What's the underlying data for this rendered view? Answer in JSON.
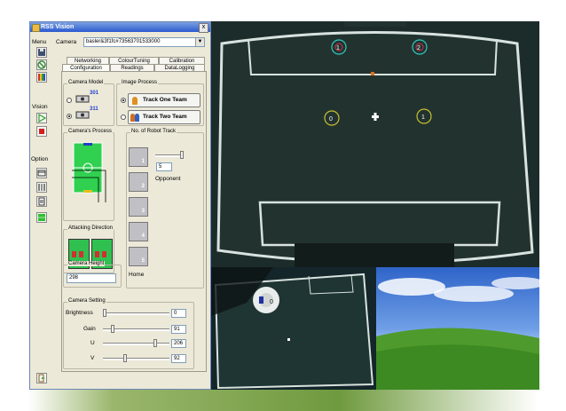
{
  "window": {
    "title": "RSS Vision",
    "close_label": "x"
  },
  "left_toolbar": {
    "menu_label": "Menu",
    "vision_label": "Vision",
    "option_label": "Option",
    "menu_icons": [
      "save-icon",
      "no-entry-icon",
      "color-bars-icon"
    ],
    "vision_icons": [
      "play-icon",
      "stop-icon"
    ],
    "option_icons": [
      "film-icon",
      "tools-icon",
      "document-icon",
      "field-icon"
    ],
    "exit_icon": "exit-icon"
  },
  "camera": {
    "label": "Camera",
    "selected": "basler&3f1fc#73563701533000"
  },
  "tabs": {
    "row1": [
      "Networking",
      "ColourTuning",
      "Calibration"
    ],
    "row2": [
      "Configuration",
      "Readings",
      "DataLogging"
    ],
    "active": "Configuration"
  },
  "camera_model": {
    "title": "Camera Model",
    "options": [
      "301",
      "311"
    ],
    "selected": "311"
  },
  "image_process": {
    "title": "Image Process",
    "options": [
      "Track One Team",
      "Track Two Team"
    ],
    "selected": "Track One Team"
  },
  "cameras_process": {
    "title": "Camera's Process"
  },
  "attacking_direction": {
    "title": "Attacking Direction"
  },
  "robot_track": {
    "title": "No. of Robot Track",
    "robots": [
      "1",
      "2",
      "3",
      "4",
      "5"
    ],
    "count": "5",
    "opponent_label": "Opponent",
    "home_label": "Home"
  },
  "camera_height": {
    "title": "Camera Height",
    "value": "298"
  },
  "camera_setting": {
    "title": "Camera Setting",
    "sliders": [
      {
        "label": "Brightness",
        "value": "0",
        "level": 0.0
      },
      {
        "label": "Gain",
        "value": "91",
        "level": 0.12
      },
      {
        "label": "U",
        "value": "206",
        "level": 0.8
      },
      {
        "label": "V",
        "value": "92",
        "level": 0.33
      }
    ]
  },
  "field_view": {
    "robot_labels": [
      "1",
      "2"
    ],
    "ball_labels": [
      "0",
      "1"
    ]
  },
  "small_view": {
    "robot_label": "0"
  },
  "colors": {
    "field": "#1a2a28",
    "line": "#e8f0ee",
    "accent": "#c8c030",
    "robot_ring": "#30c8c0",
    "ball": "#e07020"
  }
}
